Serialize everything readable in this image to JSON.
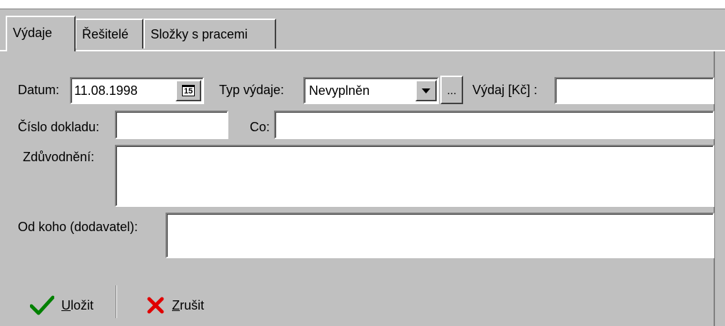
{
  "tabs": [
    {
      "label": "Výdaje",
      "active": true
    },
    {
      "label": "Řešitelé",
      "active": false
    },
    {
      "label": "Složky s pracemi",
      "active": false
    }
  ],
  "form": {
    "datum_label": "Datum:",
    "datum_value": "11.08.1998",
    "calendar_glyph": "15",
    "typ_label": "Typ výdaje:",
    "typ_value": "Nevyplněn",
    "browse_label": "...",
    "vydaj_label": "Výdaj [Kč] :",
    "vydaj_value": "",
    "cislo_label": "Číslo dokladu:",
    "cislo_value": "",
    "co_label": "Co:",
    "co_value": "",
    "zduvodneni_label": "Zdůvodnění:",
    "zduvodneni_value": "",
    "od_koho_label": "Od koho (dodavatel):",
    "od_koho_value": ""
  },
  "actions": {
    "save_accel": "U",
    "save_rest": "ložit",
    "cancel_accel": "Z",
    "cancel_rest": "rušit"
  },
  "colors": {
    "face": "#c0c0c0",
    "check": "#008000",
    "cross": "#e00000"
  },
  "icons": {
    "save": "checkmark-icon",
    "cancel": "x-icon",
    "calendar": "calendar-icon",
    "dropdown": "chevron-down-icon"
  }
}
